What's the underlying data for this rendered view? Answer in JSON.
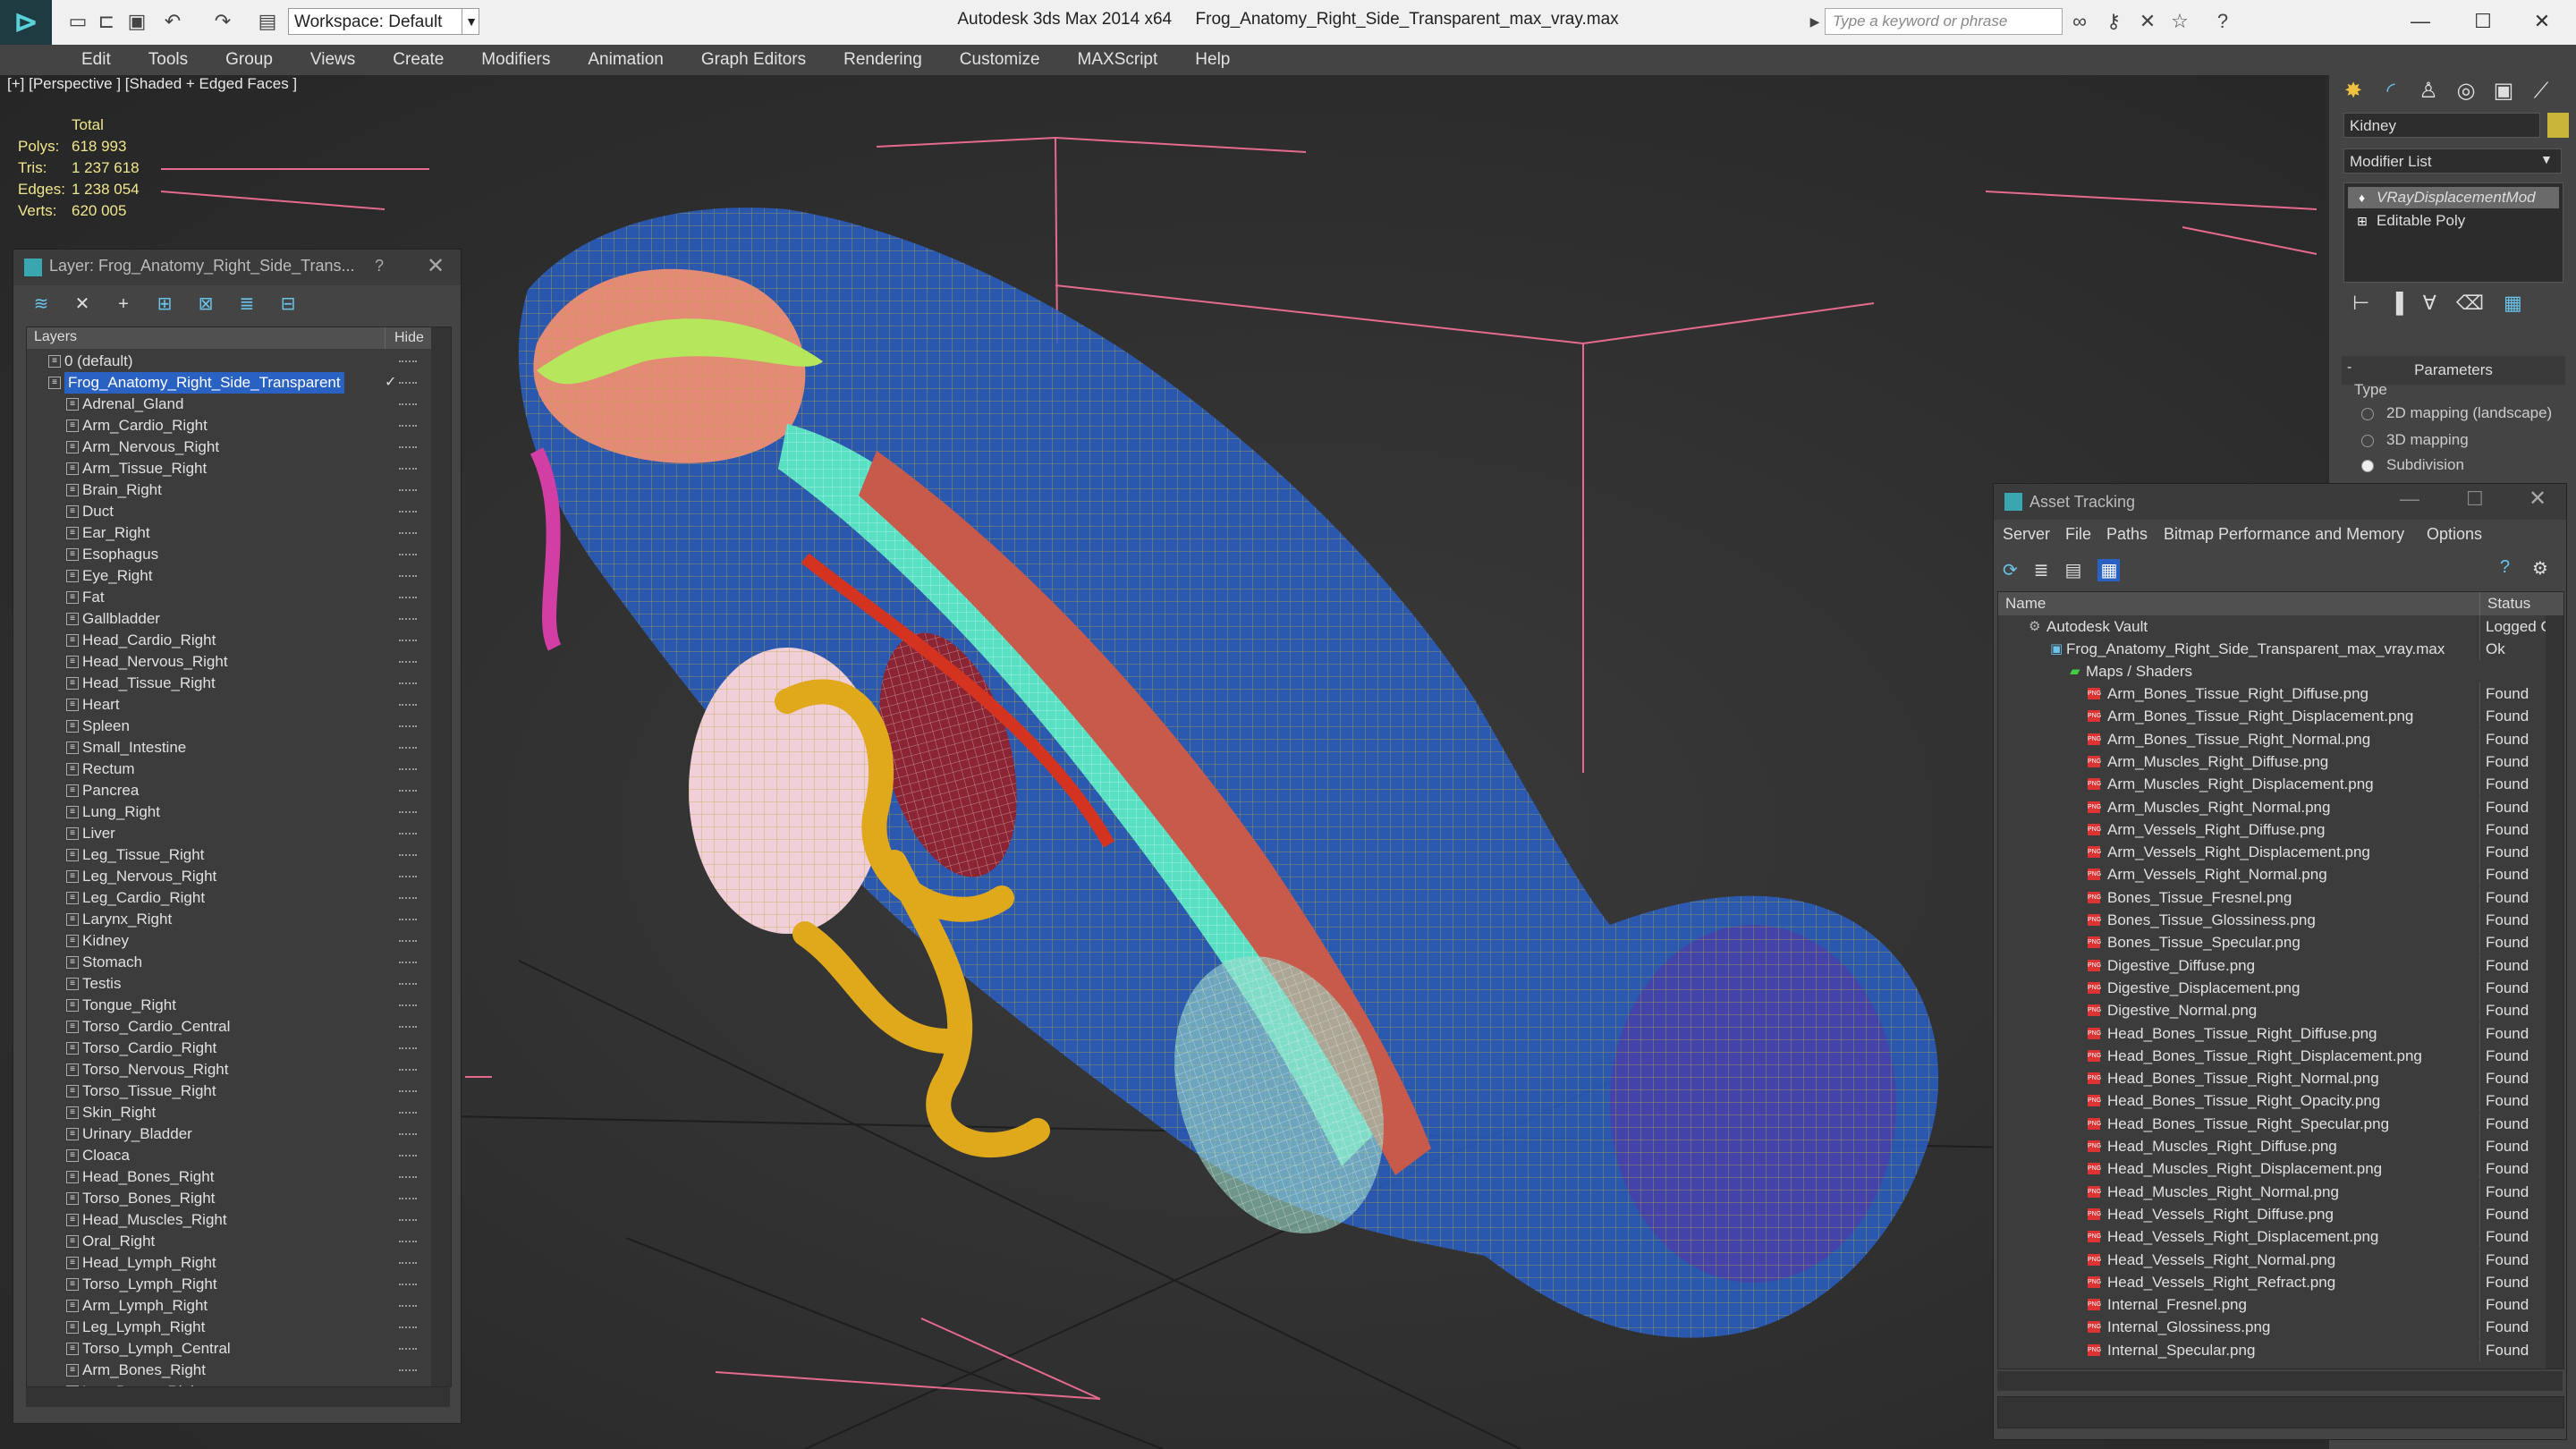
{
  "titlebar": {
    "workspace": "Workspace: Default",
    "app": "Autodesk 3ds Max  2014 x64",
    "file": "Frog_Anatomy_Right_Side_Transparent_max_vray.max",
    "search_placeholder": "Type a keyword or phrase"
  },
  "menus": [
    "Edit",
    "Tools",
    "Group",
    "Views",
    "Create",
    "Modifiers",
    "Animation",
    "Graph Editors",
    "Rendering",
    "Customize",
    "MAXScript",
    "Help"
  ],
  "viewport": {
    "label": "[+] [Perspective ] [Shaded + Edged Faces ]",
    "stats": {
      "total_label": "Total",
      "polys_label": "Polys:",
      "polys": "618 993",
      "tris_label": "Tris:",
      "tris": "1 237 618",
      "edges_label": "Edges:",
      "edges": "1 238 054",
      "verts_label": "Verts:",
      "verts": "620 005"
    }
  },
  "layer_panel": {
    "title": "Layer: Frog_Anatomy_Right_Side_Trans...",
    "help": "?",
    "col_layers": "Layers",
    "col_hide": "Hide",
    "default_layer": "0 (default)",
    "selected_layer": "Frog_Anatomy_Right_Side_Transparent",
    "items": [
      "Adrenal_Gland",
      "Arm_Cardio_Right",
      "Arm_Nervous_Right",
      "Arm_Tissue_Right",
      "Brain_Right",
      "Duct",
      "Ear_Right",
      "Esophagus",
      "Eye_Right",
      "Fat",
      "Gallbladder",
      "Head_Cardio_Right",
      "Head_Nervous_Right",
      "Head_Tissue_Right",
      "Heart",
      "Spleen",
      "Small_Intestine",
      "Rectum",
      "Pancrea",
      "Lung_Right",
      "Liver",
      "Leg_Tissue_Right",
      "Leg_Nervous_Right",
      "Leg_Cardio_Right",
      "Larynx_Right",
      "Kidney",
      "Stomach",
      "Testis",
      "Tongue_Right",
      "Torso_Cardio_Central",
      "Torso_Cardio_Right",
      "Torso_Nervous_Right",
      "Torso_Tissue_Right",
      "Skin_Right",
      "Urinary_Bladder",
      "Cloaca",
      "Head_Bones_Right",
      "Torso_Bones_Right",
      "Head_Muscles_Right",
      "Oral_Right",
      "Head_Lymph_Right",
      "Torso_Lymph_Right",
      "Arm_Lymph_Right",
      "Leg_Lymph_Right",
      "Torso_Lymph_Central",
      "Arm_Bones_Right",
      "Leg_Bones_Right"
    ]
  },
  "command_panel": {
    "object_name": "Kidney",
    "modifier_list": "Modifier List",
    "stack": [
      "VRayDisplacementMod",
      "Editable Poly"
    ],
    "params_title": "Parameters",
    "type_label": "Type",
    "radios": [
      "2D mapping (landscape)",
      "3D mapping",
      "Subdivision"
    ],
    "selected_radio": "Subdivision",
    "accent": "#c8b53a"
  },
  "asset_tracking": {
    "title": "Asset Tracking",
    "menus": [
      "Server",
      "File",
      "Paths",
      "Bitmap Performance and Memory",
      "Options"
    ],
    "col_name": "Name",
    "col_status": "Status",
    "vault": "Autodesk Vault",
    "vault_status": "Logged C",
    "file": "Frog_Anatomy_Right_Side_Transparent_max_vray.max",
    "file_status": "Ok",
    "maps": "Maps / Shaders",
    "found": "Found",
    "png_label": "PNG",
    "assets": [
      "Arm_Bones_Tissue_Right_Diffuse.png",
      "Arm_Bones_Tissue_Right_Displacement.png",
      "Arm_Bones_Tissue_Right_Normal.png",
      "Arm_Muscles_Right_Diffuse.png",
      "Arm_Muscles_Right_Displacement.png",
      "Arm_Muscles_Right_Normal.png",
      "Arm_Vessels_Right_Diffuse.png",
      "Arm_Vessels_Right_Displacement.png",
      "Arm_Vessels_Right_Normal.png",
      "Bones_Tissue_Fresnel.png",
      "Bones_Tissue_Glossiness.png",
      "Bones_Tissue_Specular.png",
      "Digestive_Diffuse.png",
      "Digestive_Displacement.png",
      "Digestive_Normal.png",
      "Head_Bones_Tissue_Right_Diffuse.png",
      "Head_Bones_Tissue_Right_Displacement.png",
      "Head_Bones_Tissue_Right_Normal.png",
      "Head_Bones_Tissue_Right_Opacity.png",
      "Head_Bones_Tissue_Right_Specular.png",
      "Head_Muscles_Right_Diffuse.png",
      "Head_Muscles_Right_Displacement.png",
      "Head_Muscles_Right_Normal.png",
      "Head_Vessels_Right_Diffuse.png",
      "Head_Vessels_Right_Displacement.png",
      "Head_Vessels_Right_Normal.png",
      "Head_Vessels_Right_Refract.png",
      "Internal_Fresnel.png",
      "Internal_Glossiness.png",
      "Internal_Specular.png"
    ]
  }
}
